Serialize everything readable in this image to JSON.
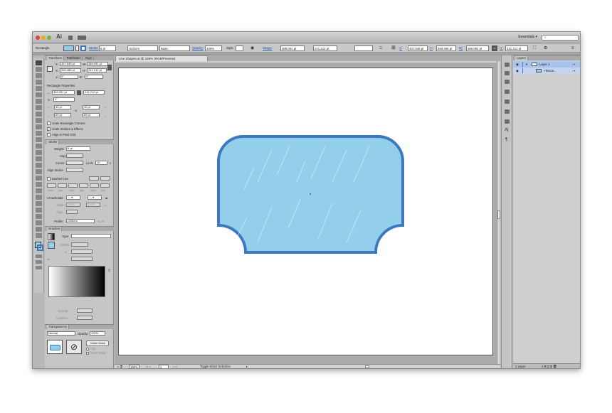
{
  "app": {
    "logo": "Ai",
    "essentials": "Essentials ▾",
    "search_placeholder": "⌕"
  },
  "control_bar": {
    "selection": "Rectangle",
    "stroke_label": "Stroke:",
    "stroke_value": "8 pt",
    "profile": "Uniform",
    "brush": "Basic",
    "opacity_label": "Opacity:",
    "opacity_value": "100%",
    "style_label": "Style:",
    "shape_label": "Shape:",
    "shape_w": "389.091 pt",
    "shape_h": "241.212 pt",
    "x_label": "X:",
    "x": "407.545 pt",
    "y_label": "Y:",
    "y": "269.485 pt",
    "w_label": "W:",
    "w": "389.091 pt",
    "h_label": "H:",
    "h": "241.212 pt"
  },
  "transform": {
    "tabs": [
      "Transform",
      "Pathfinder",
      "Align"
    ],
    "x_label": "X:",
    "x": "407.545 pt",
    "w_label": "W:",
    "w": "389.091 pt",
    "y_label": "Y:",
    "y": "269.485 pt",
    "h_label": "H:",
    "h": "241.212 pt",
    "angle": "0°",
    "shear": "0°",
    "rect_props": "Rectangle Properties",
    "rect_w": "389.091 pt",
    "rect_h": "241.212 pt",
    "rotate": "0°",
    "corner_tl": "40 pt",
    "corner_tr": "40 pt",
    "corner_bl": "60 pt",
    "corner_br": "60 pt",
    "scale_corners": "Scale Rectangle Corners",
    "scale_strokes": "Scale Strokes & Effects",
    "align_pixel": "Align to Pixel Grid"
  },
  "stroke": {
    "title": "Stroke",
    "weight_label": "Weight:",
    "weight": "8 pt",
    "cap_label": "Cap:",
    "corner_label": "Corner:",
    "limit_label": "Limit:",
    "limit": "10",
    "limit_x": "x",
    "align_label": "Align Stroke:",
    "dashed": "Dashed Line",
    "dash_labels": [
      "dash",
      "gap",
      "dash",
      "gap",
      "dash",
      "gap"
    ],
    "arrowheads": "Arrowheads:",
    "scale_label": "Scale:",
    "scale1": "100%",
    "scale2": "100%",
    "align_arrow": "Align:",
    "profile_label": "Profile:",
    "profile": "Uniform"
  },
  "gradient": {
    "title": "Gradient",
    "type_label": "Type:",
    "stroke_label": "Stroke:",
    "angle_label": "∠",
    "opacity_label": "Opacity:",
    "location_label": "Location:"
  },
  "transparency": {
    "title": "Transparency",
    "mode": "Normal",
    "opacity_label": "Opacity:",
    "opacity": "100%",
    "make_mask": "Make Mask",
    "clip": "Clip",
    "invert": "Invert Mask"
  },
  "document": {
    "tab": "Live Shapes.ai @ 165% (RGB/Preview)",
    "zoom": "165%",
    "page": "1",
    "status": "Toggle Direct Selection"
  },
  "layers": {
    "title": "Layers",
    "rows": [
      {
        "name": "Layer 1"
      },
      {
        "name": "<Recta..."
      }
    ],
    "footer": "1 Layer"
  },
  "colors": {
    "shape_fill": "#93cfea",
    "shape_stroke": "#3b78c0",
    "layer_color": "#4a7de0"
  }
}
